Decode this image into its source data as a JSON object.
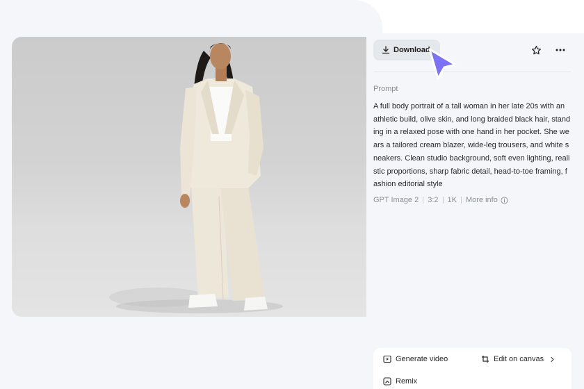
{
  "toolbar": {
    "download_label": "Download",
    "star_icon": "star-icon",
    "more_icon": "more-icon"
  },
  "prompt": {
    "heading": "Prompt",
    "text": "A full body portrait of a tall woman in her late 20s with an athletic build, olive skin, and long braided black hair, standing in a relaxed pose with one hand in her pocket. She wears a tailored cream blazer, wide-leg trousers, and white sneakers. Clean studio background, soft even lighting, realistic proportions, sharp fabric detail, head-to-toe framing, fashion editorial style"
  },
  "meta": {
    "model": "GPT Image 2",
    "ratio": "3:2",
    "resolution": "1K",
    "more_info": "More info"
  },
  "actions": {
    "generate_video": "Generate video",
    "edit_on_canvas": "Edit on canvas",
    "remix": "Remix"
  },
  "colors": {
    "panel_bg": "#f4f6f9",
    "button_bg": "#e4e7ec",
    "cursor": "#7b72f5",
    "muted_text": "#8a8f98"
  }
}
